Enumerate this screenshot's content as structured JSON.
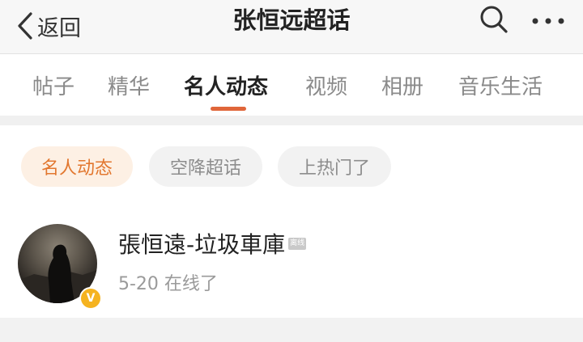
{
  "navbar": {
    "back_label": "返回",
    "title": "张恒远超话",
    "icons": [
      "chevron-left-icon",
      "search-icon",
      "more-icon"
    ]
  },
  "tabs": [
    {
      "label": "帖子",
      "active": false
    },
    {
      "label": "精华",
      "active": false
    },
    {
      "label": "名人动态",
      "active": true
    },
    {
      "label": "视频",
      "active": false
    },
    {
      "label": "相册",
      "active": false
    },
    {
      "label": "音乐生活",
      "active": false
    }
  ],
  "filters": [
    {
      "label": "名人动态",
      "active": true
    },
    {
      "label": "空降超话",
      "active": false
    },
    {
      "label": "上热门了",
      "active": false
    }
  ],
  "user": {
    "name": "張恒遠-垃圾車庫",
    "tag": "离线",
    "status": "5-20 在线了",
    "verified_mark": "V"
  },
  "colors": {
    "accent": "#e0663a",
    "chip_active_bg": "#fdf0e4",
    "chip_active_text": "#e2772f",
    "verified_badge": "#f5b320"
  }
}
